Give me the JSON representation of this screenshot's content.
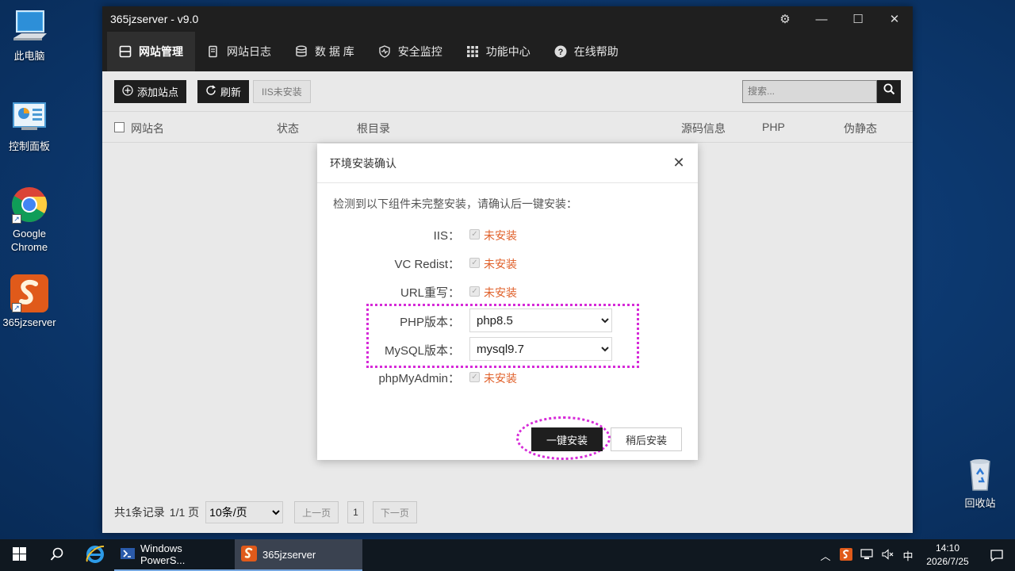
{
  "desktop": {
    "icons": [
      {
        "label": "此电脑"
      },
      {
        "label": "控制面板"
      },
      {
        "label": "Google Chrome"
      },
      {
        "label": "365jzserver"
      },
      {
        "label": "回收站"
      }
    ]
  },
  "window": {
    "title": "365jzserver - v9.0",
    "nav": [
      {
        "label": "网站管理",
        "icon": "website-icon",
        "active": true
      },
      {
        "label": "网站日志",
        "icon": "log-icon"
      },
      {
        "label": "数 据 库",
        "icon": "database-icon"
      },
      {
        "label": "安全监控",
        "icon": "shield-icon"
      },
      {
        "label": "功能中心",
        "icon": "grid-icon"
      },
      {
        "label": "在线帮助",
        "icon": "help-icon"
      }
    ],
    "toolbar": {
      "add_site": "添加站点",
      "refresh": "刷新",
      "iis_status": "IIS未安装",
      "search_placeholder": "搜索..."
    },
    "table": {
      "columns": [
        "网站名",
        "状态",
        "根目录",
        "源码信息",
        "PHP",
        "伪静态"
      ]
    },
    "footer": {
      "records": "共1条记录",
      "page_info": "1/1 页",
      "page_size": "10条/页",
      "prev": "上一页",
      "current": "1",
      "next": "下一页"
    }
  },
  "dialog": {
    "title": "环境安装确认",
    "desc": "检测到以下组件未完整安装，请确认后一键安装：",
    "components": [
      {
        "label": "IIS：",
        "status": "未安装"
      },
      {
        "label": "VC Redist：",
        "status": "未安装"
      },
      {
        "label": "URL重写：",
        "status": "未安装"
      }
    ],
    "php_label": "PHP版本：",
    "php_value": "php8.5",
    "mysql_label": "MySQL版本：",
    "mysql_value": "mysql9.7",
    "pma_label": "phpMyAdmin：",
    "pma_status": "未安装",
    "install_button": "一键安装",
    "later_button": "稍后安装",
    "highlight_color": "#d62ad8",
    "status_color": "#e0602a"
  },
  "taskbar": {
    "apps": [
      {
        "label": "Windows PowerS..."
      },
      {
        "label": "365jzserver"
      }
    ],
    "ime": "中",
    "time": "14:10",
    "date": "2026/7/25"
  }
}
